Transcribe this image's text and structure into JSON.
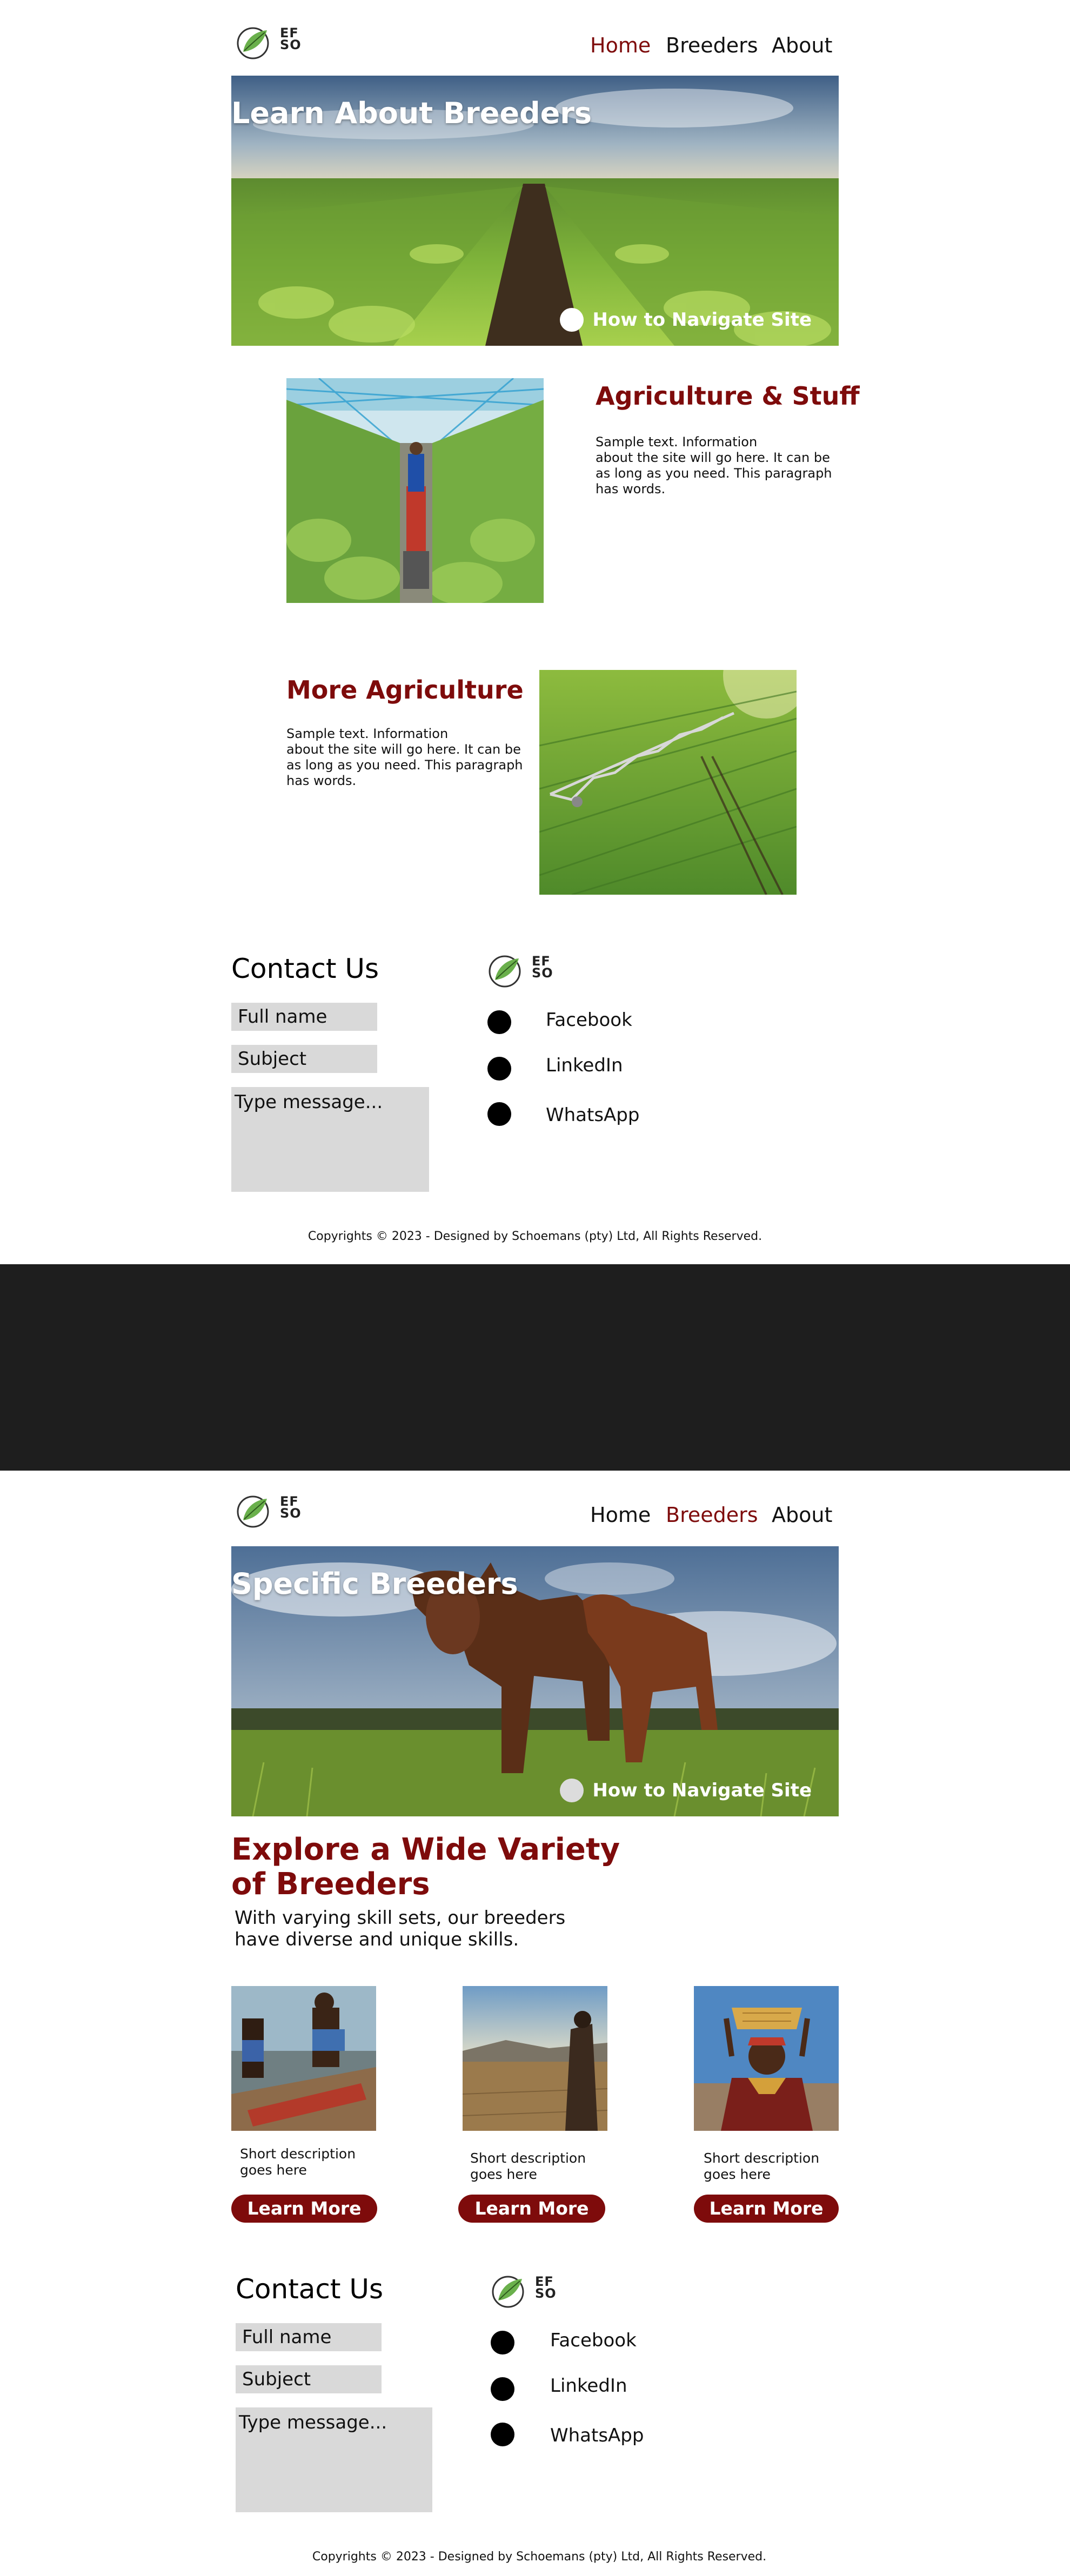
{
  "brand": {
    "logo_text_line1": "EF",
    "logo_text_line2": "SO",
    "leaf_color": "#6ab04c"
  },
  "colors": {
    "accent": "#7e0b0b",
    "field_bg": "#d9d9d9",
    "divider": "#1e1e1e"
  },
  "nav": {
    "home": "Home",
    "breeders": "Breeders",
    "about": "About"
  },
  "page1": {
    "active_nav": "Home",
    "hero": {
      "title": "Learn About Breeders",
      "howto_label": "How to Navigate Site"
    },
    "section1": {
      "heading": "Agriculture & Stuff",
      "text": "Sample text. Information\nabout the site will go here. It can be\nas long as you need. This paragraph\nhas words."
    },
    "section2": {
      "heading": "More Agriculture",
      "text": "Sample text. Information\nabout the site will go here. It can be\nas long as you need. This paragraph\nhas words."
    }
  },
  "page2": {
    "active_nav": "Breeders",
    "hero": {
      "title": "Specific Breeders",
      "howto_label": "How to Navigate Site"
    },
    "explore": {
      "title": "Explore a Wide Variety of Breeders",
      "subtitle": "With varying skill sets, our breeders have diverse and unique skills."
    },
    "cards": [
      {
        "desc": "Short description goes here",
        "button": "Learn More"
      },
      {
        "desc": "Short description goes here",
        "button": "Learn More"
      },
      {
        "desc": "Short description goes here",
        "button": "Learn More"
      }
    ]
  },
  "contact": {
    "title": "Contact Us",
    "full_name_placeholder": "Full name",
    "subject_placeholder": "Subject",
    "message_placeholder": "Type message...",
    "socials": [
      "Facebook",
      "LinkedIn",
      "WhatsApp"
    ]
  },
  "footer": {
    "copyright": "Copyrights © 2023 - Designed by Schoemans (pty) Ltd, All Rights Reserved."
  }
}
